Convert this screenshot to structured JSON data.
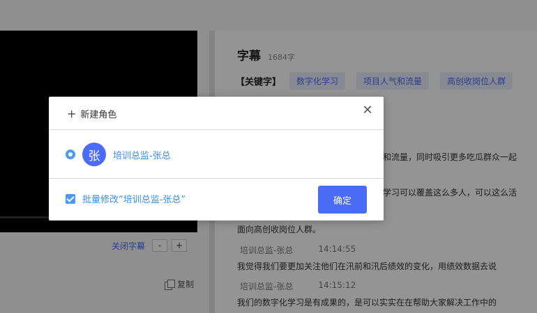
{
  "player": {
    "close_subtitle_label": "关闭字幕",
    "zoom_out_label": "-",
    "zoom_in_label": "+",
    "copy_label": "复制"
  },
  "subtitles": {
    "title": "字幕",
    "count": "1684字",
    "keywords_label": "【关键字】",
    "keywords": [
      "数字化学习",
      "项目人气和流量",
      "高创收岗位人群"
    ],
    "lines": [
      "和流量，同时吸引更多吃瓜群众一起",
      "学习可以覆盖这么多人，可以这么活",
      "面向高创收岗位人群。",
      "我觉得我们要更加关注他们在汛前和汛后绩效的变化，用绩效数据去说",
      "我们的数字化学习是有成果的，是可以实实在在帮助大家解决工作中的"
    ],
    "entries": [
      {
        "speaker": "培训总监-张总",
        "time": "14:14:55"
      },
      {
        "speaker": "培训总监-张总",
        "time": "14:15:12"
      }
    ]
  },
  "modal": {
    "new_role_label": "新建角色",
    "role": {
      "avatar_char": "张",
      "name": "培训总监-张总"
    },
    "batch_label": "批量修改“培训总监-张总”",
    "confirm_label": "确定"
  },
  "colors": {
    "accent": "#4a6cf7",
    "link": "#3a8ee6"
  }
}
